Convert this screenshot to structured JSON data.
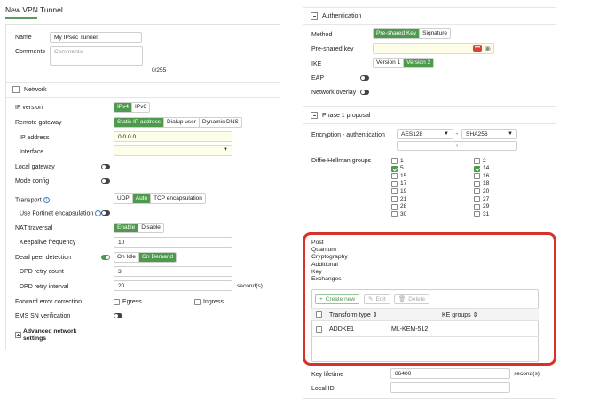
{
  "page_title": "New VPN Tunnel",
  "left": {
    "name": {
      "label": "Name",
      "value": "My IPsec Tunnel"
    },
    "comments": {
      "label": "Comments",
      "placeholder": "Comments",
      "counter": "0/255"
    },
    "network_section": "Network",
    "ip_version": {
      "label": "IP version",
      "options": [
        "IPv4",
        "IPv6"
      ]
    },
    "remote_gateway": {
      "label": "Remote gateway",
      "options": [
        "Static IP address",
        "Dialup user",
        "Dynamic DNS"
      ]
    },
    "ip_address": {
      "label": "IP address",
      "value": "0.0.0.0"
    },
    "interface": {
      "label": "Interface",
      "value": ""
    },
    "local_gateway": {
      "label": "Local gateway"
    },
    "mode_config": {
      "label": "Mode config"
    },
    "transport": {
      "label": "Transport",
      "options": [
        "UDP",
        "Auto",
        "TCP encapsulation"
      ]
    },
    "fortinet_encap": {
      "label": "Use Fortinet encapsulation"
    },
    "nat_traversal": {
      "label": "NAT traversal",
      "options": [
        "Enable",
        "Disable"
      ]
    },
    "keepalive": {
      "label": "Keepalive frequency",
      "value": "10"
    },
    "dpd": {
      "label": "Dead peer detection",
      "options": [
        "On Idle",
        "On Demand"
      ]
    },
    "dpd_retry_count": {
      "label": "DPD retry count",
      "value": "3"
    },
    "dpd_retry_interval": {
      "label": "DPD retry interval",
      "value": "20",
      "unit": "second(s)"
    },
    "fec": {
      "label": "Forward error correction",
      "egress": "Egress",
      "ingress": "Ingress"
    },
    "ems": {
      "label": "EMS SN verification"
    },
    "advanced": {
      "line1": "Advanced network",
      "line2": "settings"
    }
  },
  "right": {
    "auth_section": "Authentication",
    "method": {
      "label": "Method",
      "options": [
        "Pre-shared Key",
        "Signature"
      ]
    },
    "psk": {
      "label": "Pre-shared key",
      "value": ""
    },
    "ike": {
      "label": "IKE",
      "options": [
        "Version 1",
        "Version 2"
      ]
    },
    "eap": {
      "label": "EAP"
    },
    "network_overlay": {
      "label": "Network overlay"
    },
    "phase1_section": "Phase 1 proposal",
    "enc_auth": {
      "label": "Encryption - authentication",
      "encryption": "AES128",
      "sep": "-",
      "auth": "SHA256",
      "plus": "+"
    },
    "dh": {
      "label": "Diffie-Hellman groups",
      "col1": [
        {
          "n": "1",
          "c": false
        },
        {
          "n": "5",
          "c": true
        },
        {
          "n": "15",
          "c": false
        },
        {
          "n": "17",
          "c": false
        },
        {
          "n": "19",
          "c": false
        },
        {
          "n": "21",
          "c": false
        },
        {
          "n": "28",
          "c": false
        },
        {
          "n": "30",
          "c": false
        }
      ],
      "col2": [
        {
          "n": "2",
          "c": false
        },
        {
          "n": "14",
          "c": true
        },
        {
          "n": "16",
          "c": false
        },
        {
          "n": "18",
          "c": false
        },
        {
          "n": "20",
          "c": false
        },
        {
          "n": "27",
          "c": false
        },
        {
          "n": "29",
          "c": false
        },
        {
          "n": "31",
          "c": false
        }
      ]
    },
    "pq": {
      "label_lines": [
        "Post",
        "Quantum",
        "Cryptography",
        "Additional",
        "Key",
        "Exchanges"
      ],
      "toolbar": {
        "create": "Create new",
        "edit": "Edit",
        "delete": "Delete"
      },
      "columns": [
        "Transform type",
        "KE groups"
      ],
      "rows": [
        {
          "transform": "ADDKE1",
          "groups": "ML-KEM-512"
        }
      ]
    },
    "key_lifetime": {
      "label": "Key lifetime",
      "value": "86400",
      "unit": "second(s)"
    },
    "local_id": {
      "label": "Local ID",
      "value": ""
    }
  },
  "colors": {
    "accent": "#4d9a4d",
    "highlight": "#d9312a"
  }
}
